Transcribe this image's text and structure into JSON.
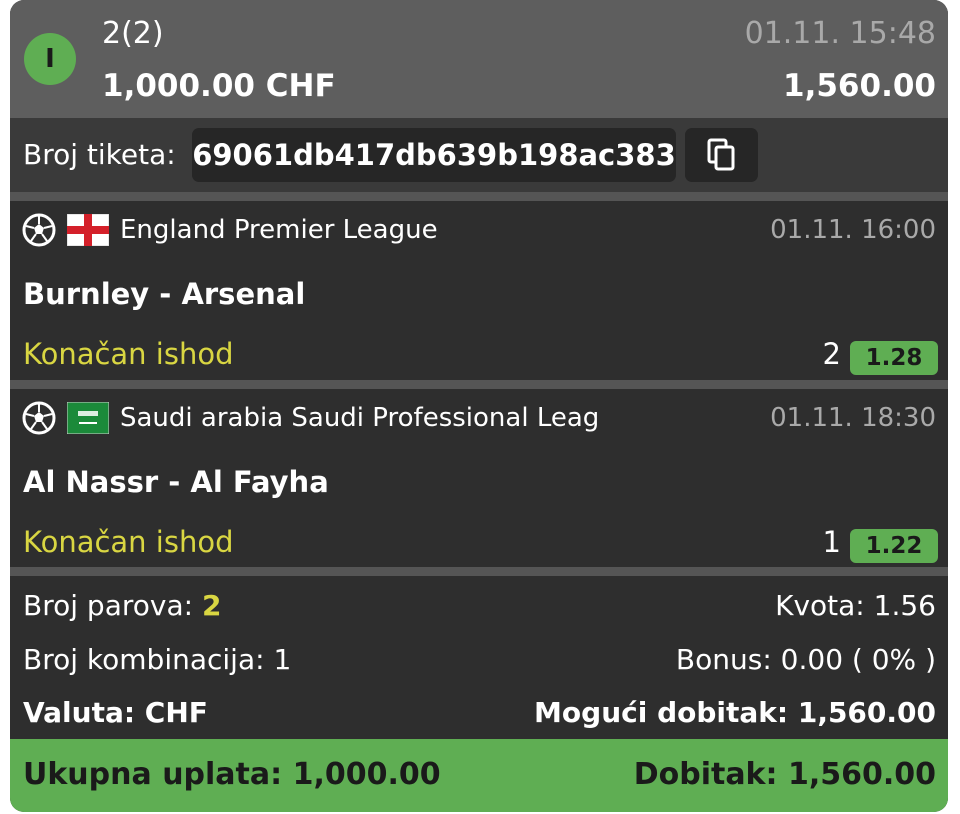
{
  "header": {
    "status_icon_letter": "I",
    "bet_type": "2(2)",
    "datetime": "01.11. 15:48",
    "stake": "1,000.00 CHF",
    "payout": "1,560.00"
  },
  "ticket": {
    "label": "Broj tiketa:",
    "id": "69061db417db639b198ac383",
    "copy_icon": "copy-icon"
  },
  "events": [
    {
      "sport_icon": "soccer-ball-icon",
      "flag_icon": "england-flag-icon",
      "league": "England Premier League",
      "time": "01.11. 16:00",
      "teams": "Burnley - Arsenal",
      "market": "Konačan ishod",
      "pick": "2",
      "odds": "1.28"
    },
    {
      "sport_icon": "soccer-ball-icon",
      "flag_icon": "saudi-arabia-flag-icon",
      "league": "Saudi arabia Saudi Professional Leag",
      "time": "01.11. 18:30",
      "teams": "Al Nassr - Al Fayha",
      "market": "Konačan ishod",
      "pick": "1",
      "odds": "1.22"
    }
  ],
  "summary": {
    "pairs_label": "Broj parova:",
    "pairs_value": "2",
    "odds_text": "Kvota: 1.56",
    "combinations_text": "Broj kombinacija: 1",
    "bonus_text": "Bonus: 0.00 ( 0% )",
    "currency_text": "Valuta: CHF",
    "possible_win_text": "Mogući dobitak: 1,560.00"
  },
  "footer": {
    "total_stake_text": "Ukupna uplata: 1,000.00",
    "win_text": "Dobitak: 1,560.00"
  },
  "colors": {
    "accent_green": "#5fae53",
    "market_yellow": "#d9d642",
    "header_gray": "#5e5e5e",
    "card_dark": "#2e2e2e"
  }
}
